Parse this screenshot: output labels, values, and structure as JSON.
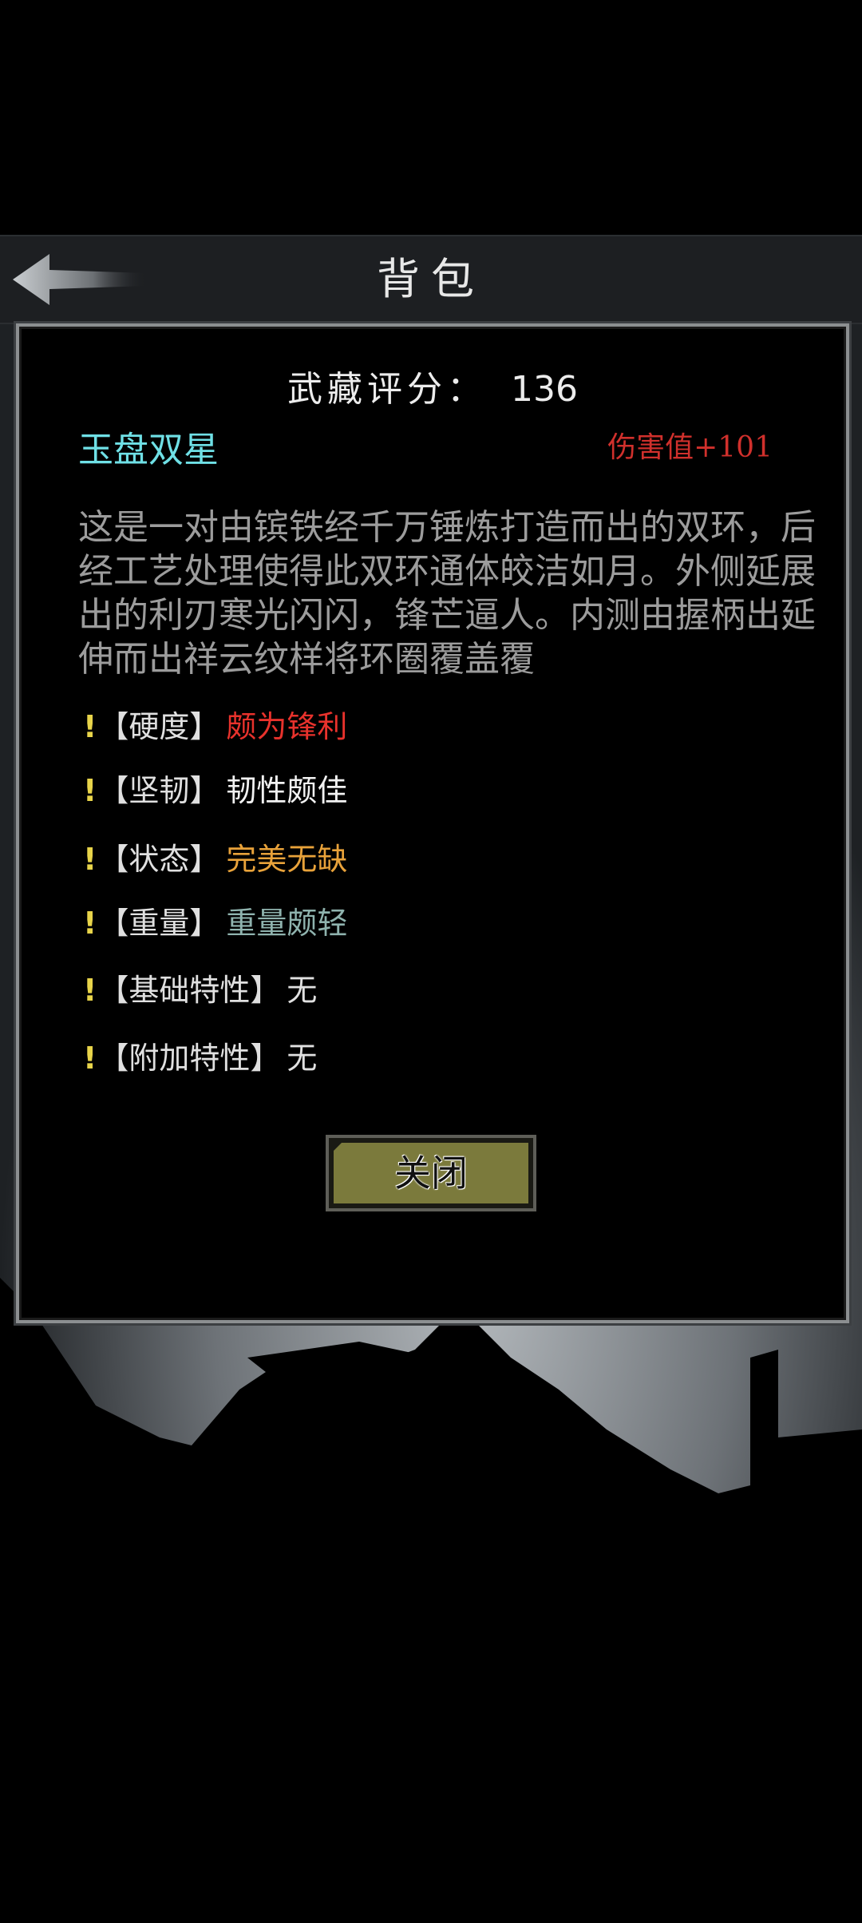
{
  "header": {
    "title": "背包",
    "back_icon": "arrow-left-icon"
  },
  "panel": {
    "score_label": "武藏评分：",
    "score_value": "136",
    "item_name": "玉盘双星",
    "damage": "伤害值+101",
    "description": "这是一对由镔铁经千万锤炼打造而出的双环，后经工艺处理使得此双环通体皎洁如月。外侧延展出的利刃寒光闪闪，锋芒逼人。内测由握柄出延伸而出祥云纹样将环圈覆盖覆",
    "attributes": [
      {
        "mark": "!",
        "label": "【硬度】",
        "value": "颇为锋利",
        "color": "#e8322c"
      },
      {
        "mark": "!",
        "label": "【坚韧】",
        "value": "韧性颇佳",
        "color": "#f2f2f2"
      },
      {
        "mark": "!",
        "label": "【状态】",
        "value": "完美无缺",
        "color": "#e8a23a"
      },
      {
        "mark": "!",
        "label": "【重量】",
        "value": "重量颇轻",
        "color": "#8fb3ae"
      },
      {
        "mark": "!",
        "label": "【基础特性】",
        "value": "无",
        "color": "#e0e0e0"
      },
      {
        "mark": "!",
        "label": "【附加特性】",
        "value": "无",
        "color": "#e0e0e0"
      }
    ],
    "close_label": "关闭"
  },
  "colors": {
    "accent_name": "#6fe0e6",
    "damage": "#d0302c",
    "button_face": "#7b7a3c",
    "attr_mark": "#e8d44a"
  }
}
